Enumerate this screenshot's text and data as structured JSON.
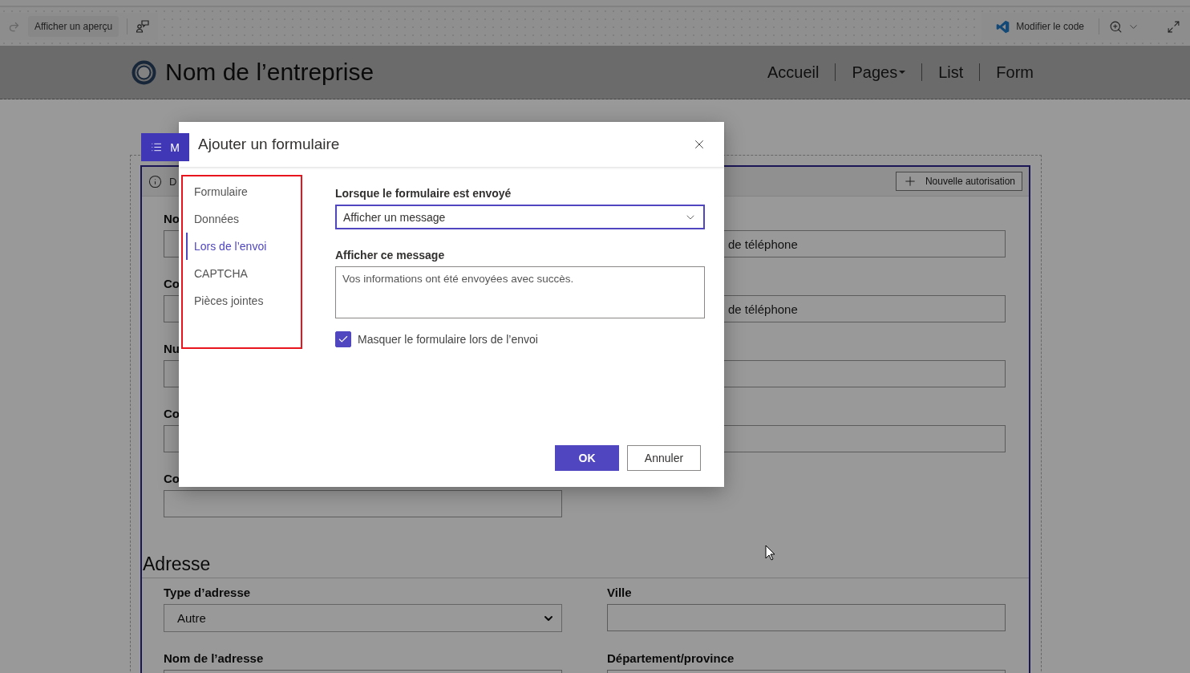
{
  "toolbar": {
    "preview_button": "Afficher un aperçu",
    "edit_code_button": "Modifier le code"
  },
  "header": {
    "company_name": "Nom de l’entreprise",
    "nav": [
      {
        "label": "Accueil",
        "dropdown": false
      },
      {
        "label": "Pages",
        "dropdown": true
      },
      {
        "label": "List",
        "dropdown": false
      },
      {
        "label": "Form",
        "dropdown": false
      }
    ]
  },
  "page": {
    "tab_label": "M",
    "info_text": "D",
    "new_permission_button": "Nouvelle autorisation",
    "left_fields": [
      {
        "label": "No"
      },
      {
        "label": "Co"
      },
      {
        "label": "Nu"
      },
      {
        "label": "Co"
      },
      {
        "label": "Co"
      }
    ],
    "right_fields": [
      {
        "kind": "text",
        "placeholder": "de téléphone"
      },
      {
        "kind": "text",
        "placeholder": "de téléphone"
      },
      {
        "kind": "text"
      },
      {
        "kind": "text"
      }
    ],
    "address": {
      "title": "Adresse",
      "fields": [
        {
          "label": "Type d’adresse",
          "kind": "select",
          "value": "Autre"
        },
        {
          "label": "Ville",
          "kind": "text"
        },
        {
          "label": "Nom de l’adresse",
          "kind": "text"
        },
        {
          "label": "Département/province",
          "kind": "text"
        }
      ]
    }
  },
  "dialog": {
    "title": "Ajouter un formulaire",
    "nav": [
      {
        "label": "Formulaire",
        "selected": false
      },
      {
        "label": "Données",
        "selected": false
      },
      {
        "label": "Lors de l’envoi",
        "selected": true
      },
      {
        "label": "CAPTCHA",
        "selected": false
      },
      {
        "label": "Pièces jointes",
        "selected": false
      }
    ],
    "submit_action": {
      "label": "Lorsque le formulaire est envoyé",
      "value": "Afficher un message"
    },
    "message": {
      "label": "Afficher ce message",
      "value": "Vos informations ont été envoyées avec succès."
    },
    "hide_form": {
      "label": "Masquer le formulaire lors de l’envoi",
      "checked": true
    },
    "buttons": {
      "ok": "OK",
      "cancel": "Annuler"
    }
  }
}
